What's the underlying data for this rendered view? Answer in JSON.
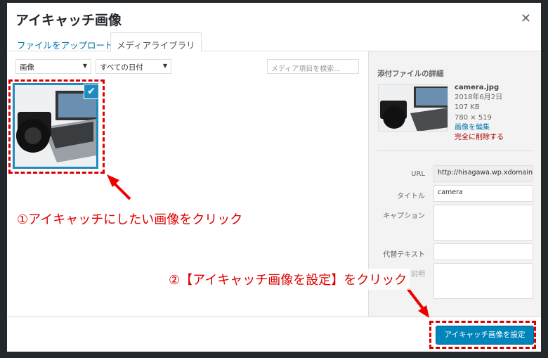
{
  "modal": {
    "title": "アイキャッチ画像",
    "close_icon": "close-icon"
  },
  "tabs": [
    {
      "label": "ファイルをアップロード",
      "active": false
    },
    {
      "label": "メディアライブラリ",
      "active": true
    }
  ],
  "filters": {
    "type": "画像",
    "date": "すべての日付",
    "search_placeholder": "メディア項目を検索..."
  },
  "attachment": {
    "heading": "添付ファイルの詳細",
    "filename": "camera.jpg",
    "date": "2018年6月2日",
    "size": "107 KB",
    "dimensions": "780 × 519",
    "edit_link": "画像を編集",
    "delete_link": "完全に削除する"
  },
  "fields": {
    "url_label": "URL",
    "url_value": "http://hisagawa.wp.xdomain.j",
    "title_label": "タイトル",
    "title_value": "camera",
    "caption_label": "キャプション",
    "alt_label": "代替テキスト",
    "desc_label": "説明"
  },
  "footer": {
    "button": "アイキャッチ画像を設定"
  },
  "annotations": {
    "step1": "①アイキャッチにしたい画像をクリック",
    "step2": "②【アイキャッチ画像を設定】をクリック",
    "color": "#dd0000"
  },
  "colors": {
    "accent": "#0085ba",
    "selected": "#1e8cbe"
  }
}
